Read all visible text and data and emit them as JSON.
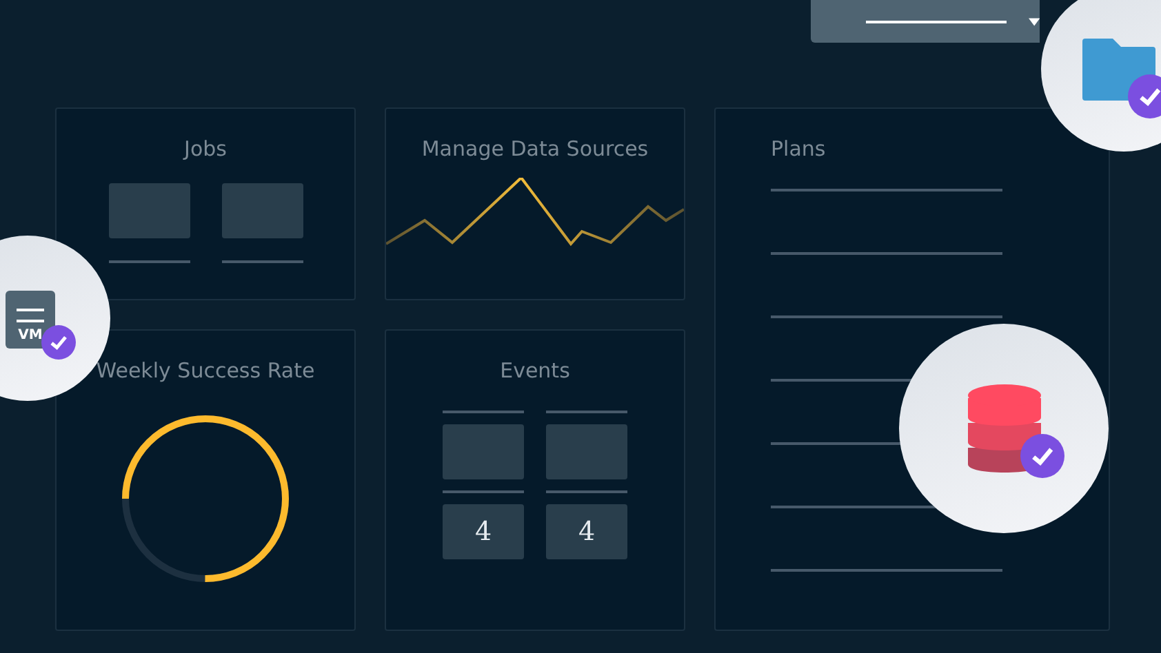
{
  "cards": [
    {
      "kind": "tiles",
      "title": "Jobs"
    },
    {
      "kind": "sparkline",
      "title": "Manage Data Sources"
    },
    {
      "kind": "list",
      "title": "Plans"
    },
    {
      "kind": "donut",
      "title": "Weekly Success Rate",
      "level": 0.75
    },
    {
      "kind": "events",
      "title": "Events",
      "counts": [
        "4",
        "4"
      ]
    }
  ],
  "badges": [
    {
      "kind": "folder"
    },
    {
      "kind": "vm",
      "label": "VM"
    },
    {
      "kind": "database"
    }
  ]
}
